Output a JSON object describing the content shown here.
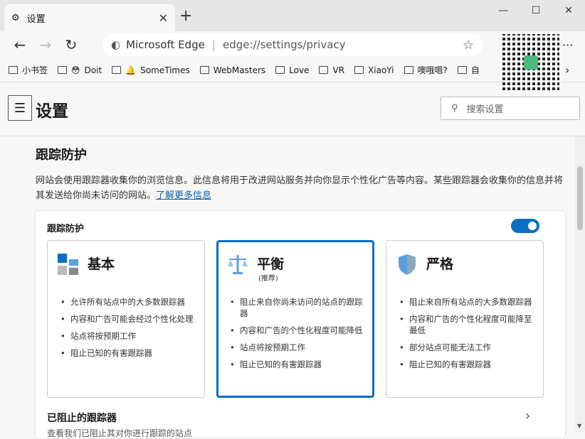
{
  "tab": {
    "title": "设置",
    "close": "✕"
  },
  "window": {
    "new_tab": "+",
    "minimize": "—",
    "maximize": "☐",
    "close": "✕"
  },
  "address": {
    "site": "Microsoft Edge",
    "url": "edge://settings/privacy"
  },
  "bookmarks": [
    "小书签",
    "Doit",
    "SomeTimes",
    "WebMasters",
    "Love",
    "VR",
    "XiaoYi",
    "噢哦嗯?",
    "自"
  ],
  "header": {
    "title": "设置",
    "search_placeholder": "搜索设置"
  },
  "section": {
    "title": "跟踪防护",
    "description": "网站会使用跟踪器收集你的浏览信息。此信息将用于改进网站服务并向你显示个性化广告等内容。某些跟踪器会收集你的信息并将其发送给你尚未访问的网站。",
    "learn_more": "了解更多信息"
  },
  "panel": {
    "title": "跟踪防护",
    "enabled": true,
    "cards": [
      {
        "name": "基本",
        "sub": "",
        "selected": false,
        "items": [
          "允许所有站点中的大多数跟踪器",
          "内容和广告可能会经过个性化处理",
          "站点将按预期工作",
          "阻止已知的有害跟踪器"
        ]
      },
      {
        "name": "平衡",
        "sub": "(推荐)",
        "selected": true,
        "items": [
          "阻止来自你尚未访问的站点的跟踪器",
          "内容和广告的个性化程度可能降低",
          "站点将按预期工作",
          "阻止已知的有害跟踪器"
        ]
      },
      {
        "name": "严格",
        "sub": "",
        "selected": false,
        "items": [
          "阻止来自所有站点的大多数跟踪器",
          "内容和广告的个性化程度可能降至最低",
          "部分站点可能无法工作",
          "阻止已知的有害跟踪器"
        ]
      }
    ],
    "blocked_title": "已阻止的跟踪器",
    "blocked_sub": "查看我们已阻止其对你进行跟踪的站点"
  },
  "colors": {
    "accent": "#0c6dc4"
  }
}
